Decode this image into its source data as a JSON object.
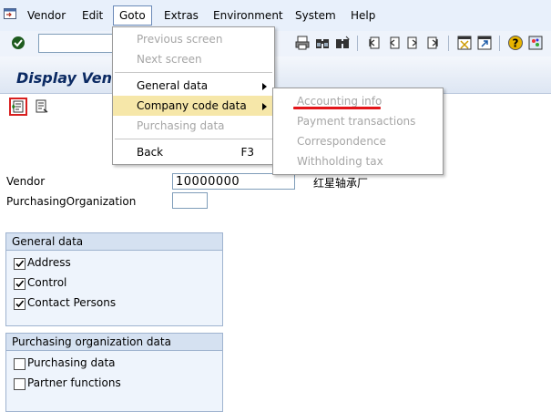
{
  "menubar": {
    "items": [
      "Vendor",
      "Edit",
      "Goto",
      "Extras",
      "Environment",
      "System",
      "Help"
    ],
    "active": "Goto"
  },
  "title": "Display Vendor",
  "goto_menu": [
    {
      "label": "Previous screen",
      "enabled": false
    },
    {
      "label": "Next screen",
      "enabled": false
    },
    {
      "label": "General data",
      "enabled": true,
      "submenu": true
    },
    {
      "label": "Company code data",
      "enabled": true,
      "submenu": true,
      "highlighted": true
    },
    {
      "label": "Purchasing data",
      "enabled": false
    },
    {
      "label": "Back",
      "enabled": true,
      "shortcut": "F3"
    }
  ],
  "company_code_submenu": [
    {
      "label": "Accounting info",
      "enabled": false,
      "underlined_red": true
    },
    {
      "label": "Payment transactions",
      "enabled": false
    },
    {
      "label": "Correspondence",
      "enabled": false
    },
    {
      "label": "Withholding tax",
      "enabled": false
    }
  ],
  "form": {
    "vendor_label": "Vendor",
    "vendor_value": "10000000",
    "vendor_name": "红星轴承厂",
    "purch_org_label": "PurchasingOrganization",
    "purch_org_value": ""
  },
  "general_data": {
    "title": "General data",
    "items": [
      {
        "label": "Address",
        "checked": true
      },
      {
        "label": "Control",
        "checked": true
      },
      {
        "label": "Contact Persons",
        "checked": true
      }
    ]
  },
  "purch_org_data": {
    "title": "Purchasing organization data",
    "items": [
      {
        "label": "Purchasing data",
        "checked": false
      },
      {
        "label": "Partner functions",
        "checked": false
      }
    ]
  },
  "colors": {
    "menubar_bg": "#e8f0fb",
    "highlight": "#f6e7a9",
    "disabled_text": "#a6a6a6",
    "annotation_red": "#e3151a",
    "title_text": "#0b2a63"
  }
}
